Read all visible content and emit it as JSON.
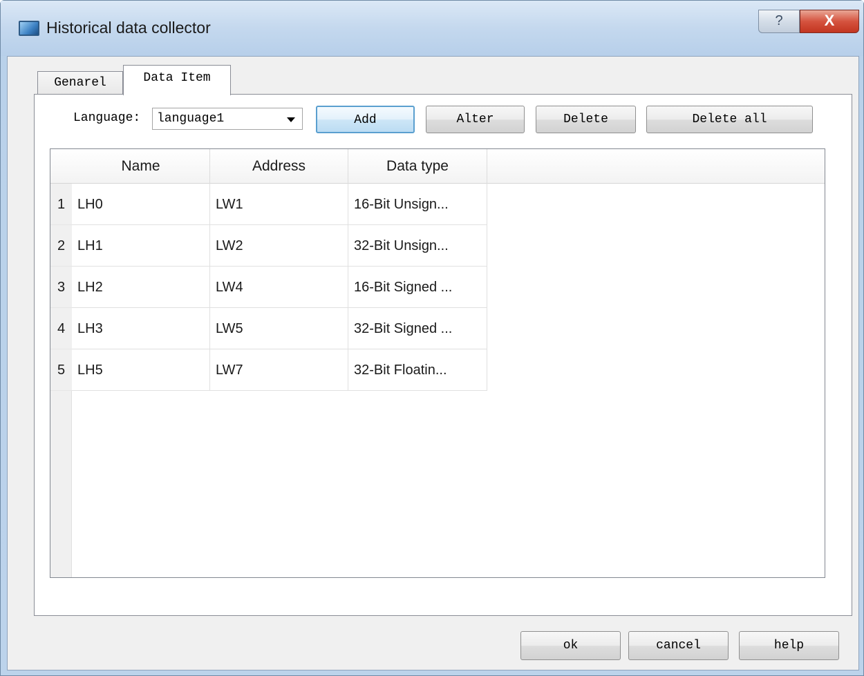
{
  "window": {
    "title": "Historical data collector",
    "help_glyph": "?",
    "close_glyph": "X"
  },
  "tabs": [
    {
      "label": "Genarel",
      "active": false
    },
    {
      "label": "Data Item",
      "active": true
    }
  ],
  "toolbar": {
    "language_label": "Language:",
    "language_value": "language1",
    "add_label": "Add",
    "alter_label": "Alter",
    "delete_label": "Delete",
    "delete_all_label": "Delete all"
  },
  "table": {
    "columns": [
      "Name",
      "Address",
      "Data type"
    ],
    "rows": [
      {
        "num": "1",
        "name": "LH0",
        "address": "LW1",
        "data_type": "16-Bit Unsign..."
      },
      {
        "num": "2",
        "name": "LH1",
        "address": "LW2",
        "data_type": "32-Bit Unsign..."
      },
      {
        "num": "3",
        "name": "LH2",
        "address": "LW4",
        "data_type": "16-Bit Signed ..."
      },
      {
        "num": "4",
        "name": "LH3",
        "address": "LW5",
        "data_type": "32-Bit Signed ..."
      },
      {
        "num": "5",
        "name": "LH5",
        "address": "LW7",
        "data_type": "32-Bit Floatin..."
      }
    ]
  },
  "footer": {
    "ok_label": "ok",
    "cancel_label": "cancel",
    "help_label": "help"
  },
  "colors": {
    "title_bar": "#c4d8ee",
    "close_button": "#c23520",
    "add_button_focus": "#5a9fcf"
  }
}
